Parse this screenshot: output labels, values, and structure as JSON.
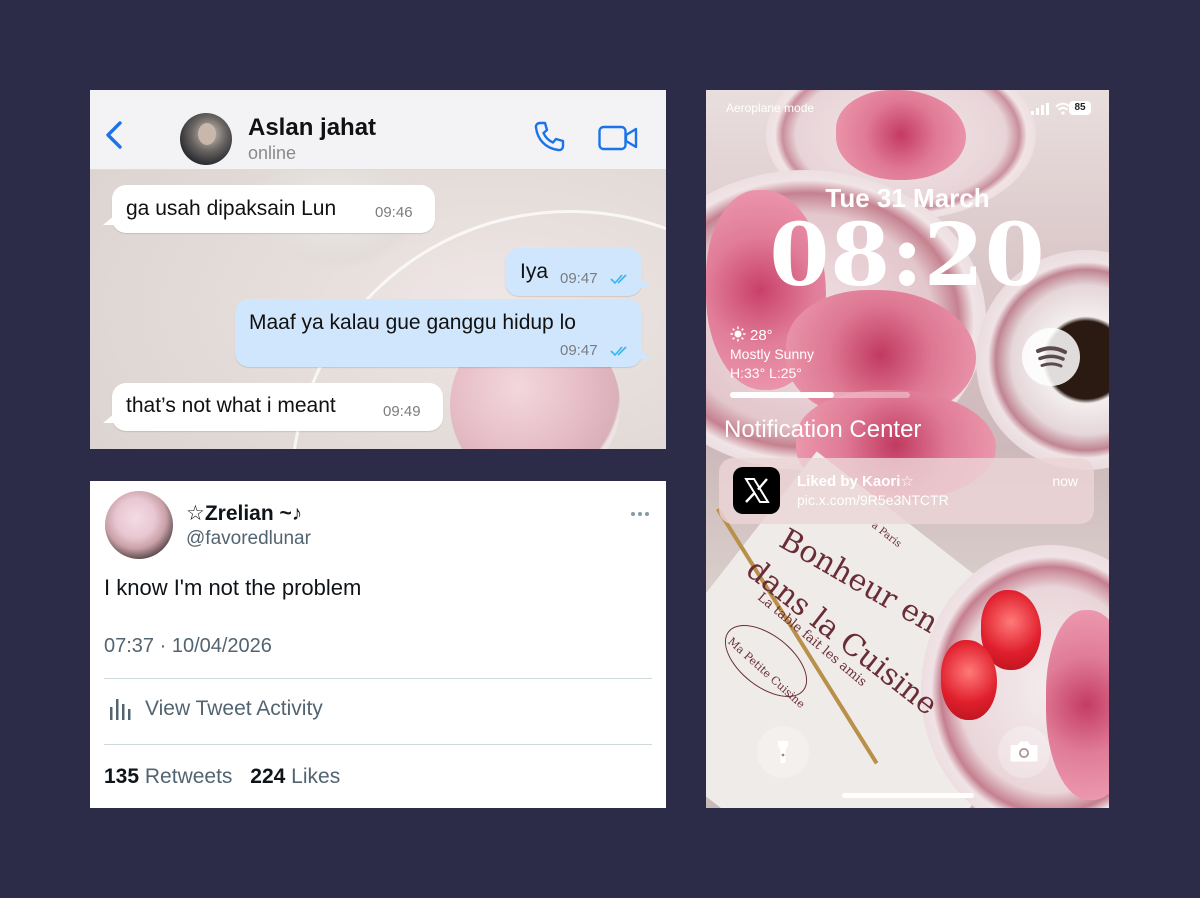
{
  "chat": {
    "contact_name": "Aslan jahat",
    "contact_status": "online",
    "messages": [
      {
        "direction": "in",
        "text": "ga usah dipaksain Lun",
        "time": "09:46"
      },
      {
        "direction": "out",
        "text": "Iya",
        "time": "09:47",
        "read": true
      },
      {
        "direction": "out",
        "text": "Maaf ya kalau gue ganggu hidup lo",
        "time": "09:47",
        "read": true
      },
      {
        "direction": "in",
        "text": "that’s not what i meant",
        "time": "09:49"
      }
    ],
    "accent_color": "#1a73e8",
    "tick_color": "#34b7f1"
  },
  "tweet": {
    "display_name": "☆Zrelian ~♪",
    "handle": "@favoredlunar",
    "text": "I know I'm not the problem",
    "timestamp": "07:37 · 10/04/2026",
    "activity_label": "View Tweet Activity",
    "retweets_count": "135",
    "retweets_label": "Retweets",
    "likes_count": "224",
    "likes_label": "Likes"
  },
  "lockscreen": {
    "status_left": "Aeroplane mode",
    "battery": "85",
    "date": "Tue 31 March",
    "time": "08:20",
    "weather": {
      "temp": "28°",
      "condition": "Mostly Sunny",
      "range": "H:33° L:25°"
    },
    "media_progress": 0.58,
    "notification_center_label": "Notification Center",
    "notification": {
      "app_icon": "x-logo-icon",
      "title": "Liked by Kaori☆",
      "body": "pic.x.com/9R5e3NTCTR",
      "time": "now"
    },
    "napkin_lines": [
      "Bonheur en",
      "dans la Cuisine",
      "La table fait les amis",
      "Ma Petite Cuisine",
      "a Paris"
    ]
  }
}
